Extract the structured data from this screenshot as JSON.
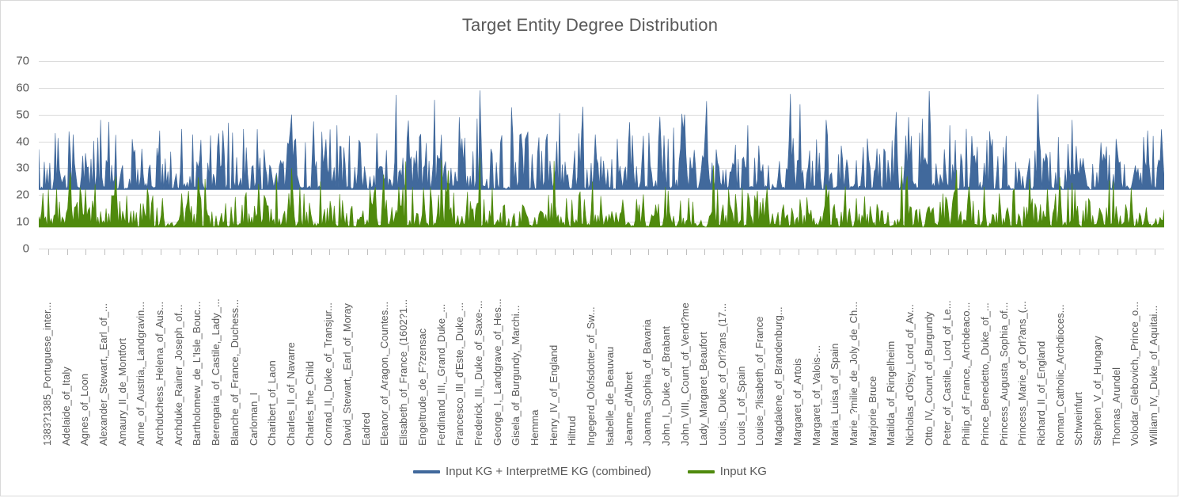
{
  "chart_data": {
    "type": "area",
    "title": "Target Entity Degree Distribution",
    "xlabel": "",
    "ylabel": "",
    "ylim": [
      0,
      70
    ],
    "yticks": [
      0,
      10,
      20,
      30,
      40,
      50,
      60,
      70
    ],
    "grid": true,
    "legend_position": "bottom",
    "colors": {
      "combined": "#41699C",
      "input": "#4F8A0D",
      "gridline": "#d9d9d9",
      "text": "#595959",
      "border": "#d9d9d9"
    },
    "series": [
      {
        "name": "Input KG + InterpretME KG (combined)",
        "color": "#41699C",
        "baseline": 22,
        "typical_min": 22,
        "typical_max": 34,
        "global_max": 59,
        "global_min": 21,
        "n_points": 820,
        "notes": "Dense blue band filling from ~22 up to spikes between 30 and 59; highest spike ~59 near Francesco_III_d'Este,_Duke_...; other notable spikes ~55, ~50, ~49, ~48."
      },
      {
        "name": "Input KG",
        "color": "#4F8A0D",
        "baseline": 8,
        "typical_min": 8,
        "typical_max": 16,
        "global_max": 34,
        "global_min": 8,
        "n_points": 820,
        "notes": "Dense green band filling from ~8 up to spikes between 12 and 34."
      }
    ],
    "categories": [
      "1383?1385_Portuguese_inter...",
      "Adelaide_of_Italy",
      "Agnes_of_Loon",
      "Alexander_Stewart,_Earl_of_...",
      "Amaury_II_de_Montfort",
      "Anne_of_Austria,_Landgravin...",
      "Archduchess_Helena_of_Aus...",
      "Archduke_Rainer_Joseph_of...",
      "Bartholomew_de_L'Isle_Bouc...",
      "Berengaria_of_Castile,_Lady_...",
      "Blanche_of_France,_Duchess...",
      "Carloman_I",
      "Charibert_of_Laon",
      "Charles_II_of_Navarre",
      "Charles_the_Child",
      "Conrad_II,_Duke_of_Transjur...",
      "David_Stewart,_Earl_of_Moray",
      "Eadred",
      "Eleanor_of_Aragon,_Countes...",
      "Elisabeth_of_France_(1602?1...",
      "Engeltrude_de_F?zensac",
      "Ferdinand_III,_Grand_Duke_...",
      "Francesco_III_d'Este,_Duke_...",
      "Frederick_III,_Duke_of_Saxe-...",
      "George_I,_Landgrave_of_Hes...",
      "Gisela_of_Burgundy,_Marchi...",
      "Hemma",
      "Henry_IV_of_England",
      "Hiltrud",
      "Ingegerd_Olofsdotter_of_Sw...",
      "Isabelle_de_Beauvau",
      "Jeanne_d'Albret",
      "Joanna_Sophia_of_Bavaria",
      "John_I,_Duke_of_Brabant",
      "John_VIII,_Count_of_Vend?me",
      "Lady_Margaret_Beaufort",
      "Louis,_Duke_of_Orl?ans_(17...",
      "Louis_I_of_Spain",
      "Louise_?lisabeth_of_France",
      "Magdalene_of_Brandenburg...",
      "Margaret_of_Artois",
      "Margaret_of_Valois-...",
      "Maria_Luisa_of_Spain",
      "Marie_?milie_de_Joly_de_Ch...",
      "Marjorie_Bruce",
      "Matilda_of_Ringelheim",
      "Nicholas_d'Oisy,_Lord_of_Av...",
      "Otto_IV,_Count_of_Burgundy",
      "Peter_of_Castile,_Lord_of_Le...",
      "Philip_of_France,_Archdeaco...",
      "Prince_Benedetto,_Duke_of_...",
      "Princess_Augusta_Sophia_of...",
      "Princess_Marie_of_Orl?ans_(...",
      "Richard_II_of_England",
      "Roman_Catholic_Archdioces...",
      "Schweinfurt",
      "Stephen_V_of_Hungary",
      "Thomas_Arundel",
      "Volodar_Glebovich,_Prince_o...",
      "William_IV,_Duke_of_Aquitai..."
    ]
  },
  "legend": [
    {
      "label": "Input KG + InterpretME KG (combined)",
      "color": "#41699C"
    },
    {
      "label": "Input KG",
      "color": "#4F8A0D"
    }
  ]
}
